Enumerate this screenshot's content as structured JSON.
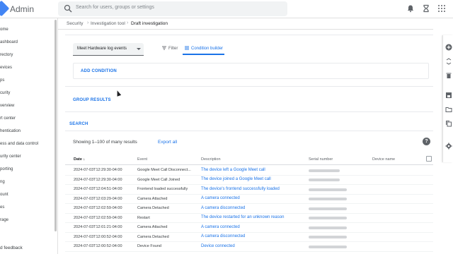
{
  "app": {
    "title": "Admin"
  },
  "search": {
    "placeholder": "Search for users, groups or settings"
  },
  "sidebar": {
    "items": [
      {
        "label": "ome"
      },
      {
        "label": "ashboard"
      },
      {
        "label": "rectory"
      },
      {
        "label": "evices"
      },
      {
        "label": "ps"
      },
      {
        "label": "curity"
      },
      {
        "label": "verview"
      },
      {
        "label": "rt center"
      },
      {
        "label": "hentication"
      },
      {
        "label": "ess and data control"
      },
      {
        "label": "urity center"
      },
      {
        "label": "porting"
      },
      {
        "label": "ng"
      },
      {
        "label": "ount"
      },
      {
        "label": "es"
      },
      {
        "label": "rage"
      }
    ],
    "feedback": "d feedback"
  },
  "breadcrumb": {
    "items": [
      "Security",
      "Investigation tool",
      "Draft investigation"
    ]
  },
  "query": {
    "source": "Meet Hardware log events",
    "tab_filter": "Filter",
    "tab_builder": "Condition builder",
    "add_condition": "ADD CONDITION",
    "group_results": "GROUP RESULTS",
    "search": "SEARCH"
  },
  "results": {
    "showing": "Showing 1–100 of many results",
    "export": "Export all",
    "columns": {
      "date": "Date",
      "event": "Event",
      "description": "Description",
      "serial": "Serial number",
      "device": "Device name"
    },
    "rows": [
      {
        "date": "2024-07-03T12:29:30-04:00",
        "event": "Google Meet Call Disconnect...",
        "description": "The device left a Google Meet call"
      },
      {
        "date": "2024-07-03T12:29:30-04:00",
        "event": "Google Meet Call Joined",
        "description": "The device joined a Google Meet call"
      },
      {
        "date": "2024-07-03T12:04:51-04:00",
        "event": "Frontend loaded successfully",
        "description": "The device's frontend successfully loaded"
      },
      {
        "date": "2024-07-03T12:03:29-04:00",
        "event": "Camera Attached",
        "description": "A camera connected"
      },
      {
        "date": "2024-07-03T12:02:59-04:00",
        "event": "Camera Detached",
        "description": "A camera disconnected"
      },
      {
        "date": "2024-07-03T12:02:59-04:00",
        "event": "Restart",
        "description": "The device restarted for an unknown reason"
      },
      {
        "date": "2024-07-03T12:01:21-04:00",
        "event": "Camera Attached",
        "description": "A camera connected"
      },
      {
        "date": "2024-07-03T12:00:52-04:00",
        "event": "Camera Detached",
        "description": "A camera disconnected"
      },
      {
        "date": "2024-07-03T12:00:52-04:00",
        "event": "Device Found",
        "description": "Device connected"
      }
    ]
  },
  "colors": {
    "accent": "#1a73e8",
    "brand": "#4285f4"
  }
}
